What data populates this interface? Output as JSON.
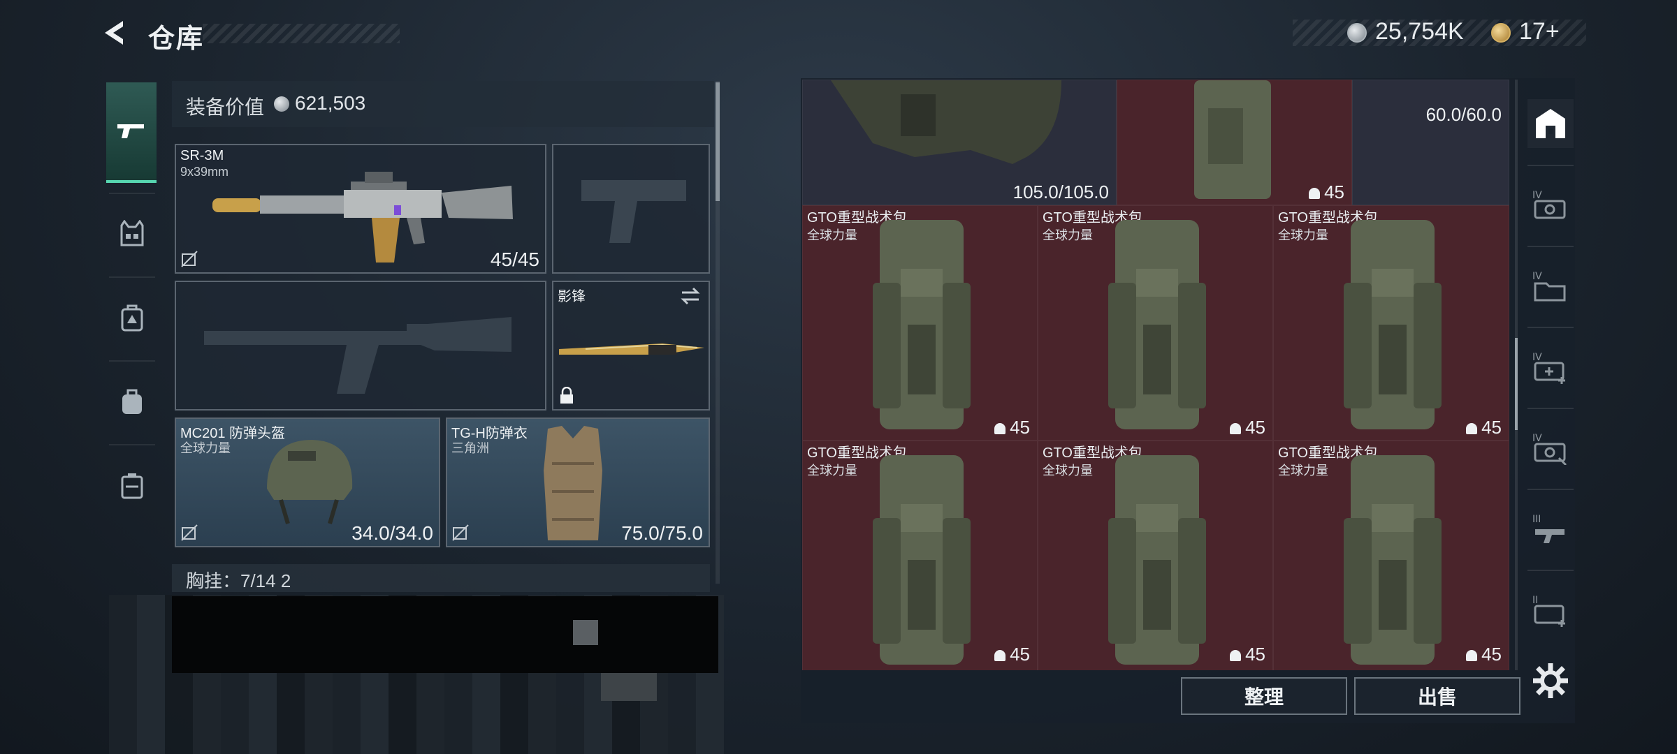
{
  "header": {
    "title": "仓库",
    "money": "25,754K",
    "tokens": "17+"
  },
  "left_nav": {
    "tabs": [
      "gun-icon",
      "vest-icon",
      "backpack-armor-icon",
      "backpack-icon",
      "case-icon"
    ]
  },
  "equipment": {
    "value_label": "装备价值",
    "value": "621,503",
    "primary_weapon": {
      "name": "SR-3M",
      "caliber": "9x39mm",
      "ammo": "45/45"
    },
    "melee": {
      "name": "影锋"
    },
    "helmet": {
      "name": "MC201 防弹头盔",
      "source": "全球力量",
      "durability": "34.0/34.0"
    },
    "armor": {
      "name": "TG-H防弹衣",
      "source": "三角洲",
      "durability": "75.0/75.0"
    },
    "chest_rig_label": "胸挂：7/14  2"
  },
  "inventory": {
    "top_row": [
      {
        "kind": "vest",
        "value": "105.0/105.0",
        "color": "dark"
      },
      {
        "kind": "backpack",
        "count": "45",
        "color": "red"
      },
      {
        "kind": "unknown",
        "value": "60.0/60.0",
        "color": "dark"
      }
    ],
    "items": [
      {
        "name": "GTO重型战术包",
        "source": "全球力量",
        "count": "45"
      },
      {
        "name": "GTO重型战术包",
        "source": "全球力量",
        "count": "45"
      },
      {
        "name": "GTO重型战术包",
        "source": "全球力量",
        "count": "45"
      },
      {
        "name": "GTO重型战术包",
        "source": "全球力量",
        "count": "45"
      },
      {
        "name": "GTO重型战术包",
        "source": "全球力量",
        "count": "45"
      },
      {
        "name": "GTO重型战术包",
        "source": "全球力量",
        "count": "45"
      }
    ]
  },
  "buttons": {
    "sort": "整理",
    "sell": "出售"
  },
  "right_nav": {
    "tabs": [
      "home-safe-icon",
      "tier-iv-case-icon",
      "tier-iv-folder-icon",
      "tier-iv-medkit-icon",
      "tier-iv-tool-icon",
      "tier-iii-gun-case-icon",
      "tier-ii-medkit-icon"
    ]
  },
  "colors": {
    "accent": "#57d6b0",
    "red_cell": "#4a242b",
    "dark_cell": "#2b2e3c"
  }
}
